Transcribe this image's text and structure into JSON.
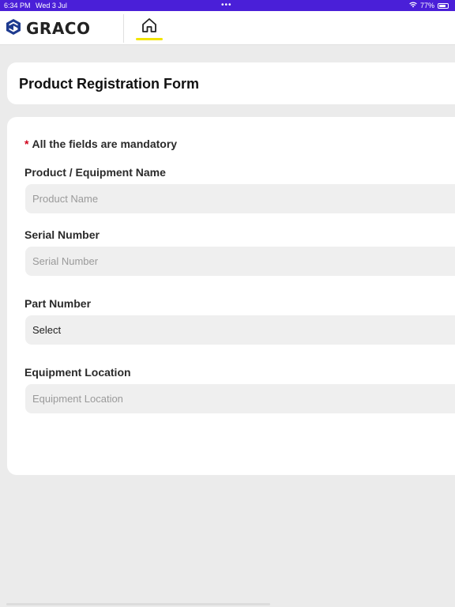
{
  "status_bar": {
    "time": "6:34 PM",
    "date": "Wed 3 Jul",
    "dots": "•••",
    "battery_percent": "77%",
    "battery_level": 0.77,
    "icons": [
      "wifi-icon",
      "battery-icon"
    ]
  },
  "header": {
    "logo_text": "GRACO",
    "logo_icon": "graco-logo-icon",
    "home_icon": "home-icon",
    "accent_color": "#f2e400"
  },
  "page": {
    "title": "Product Registration Form"
  },
  "form": {
    "mandatory_asterisk": "*",
    "mandatory_note": "All the fields are mandatory",
    "product_name": {
      "label": "Product / Equipment Name",
      "placeholder": "Product Name",
      "value": ""
    },
    "serial_number": {
      "label": "Serial Number",
      "placeholder": "Serial Number",
      "value": ""
    },
    "part_number": {
      "label": "Part Number",
      "selected": "Select"
    },
    "equipment_location": {
      "label": "Equipment Location",
      "placeholder": "Equipment Location",
      "value": ""
    }
  },
  "colors": {
    "status_bar": "#4a1fd8",
    "required_marker": "#d0021b",
    "background": "#ebebeb"
  }
}
